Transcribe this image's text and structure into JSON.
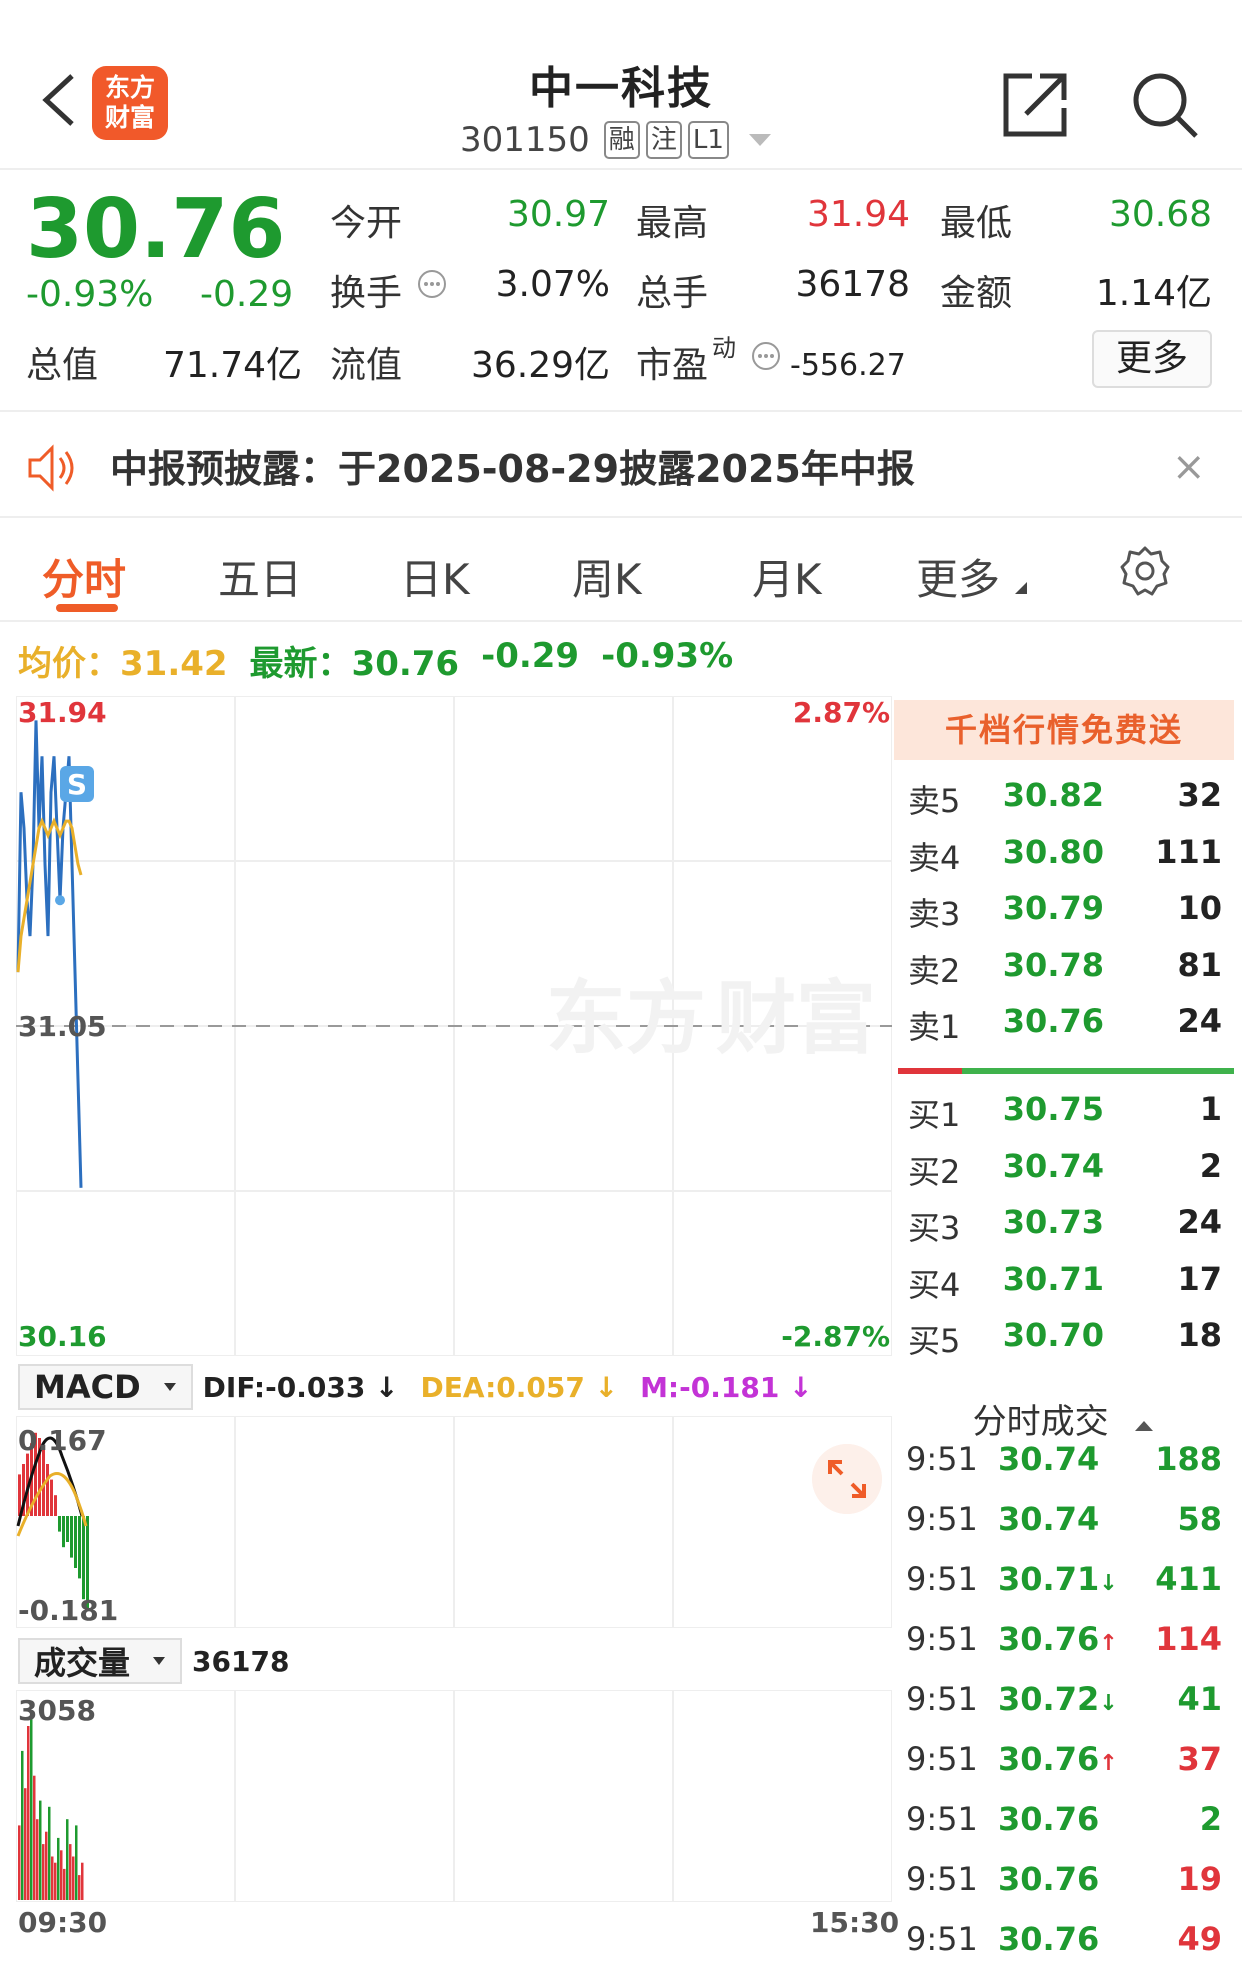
{
  "header": {
    "logo_line1": "东方",
    "logo_line2": "财富",
    "title": "中一科技",
    "code": "301150",
    "tags": [
      "融",
      "注",
      "L1"
    ]
  },
  "quote": {
    "price": "30.76",
    "pct": "-0.93%",
    "change": "-0.29",
    "fields": [
      {
        "label": "今开",
        "value": "30.97",
        "color": "green"
      },
      {
        "label": "最高",
        "value": "31.94",
        "color": "red"
      },
      {
        "label": "最低",
        "value": "30.68",
        "color": "green"
      },
      {
        "label": "换手",
        "value": "3.07%",
        "color": "black"
      },
      {
        "label": "总手",
        "value": "36178",
        "color": "black"
      },
      {
        "label": "金额",
        "value": "1.14亿",
        "color": "black"
      },
      {
        "label": "总值",
        "value": "71.74亿",
        "color": "black"
      },
      {
        "label": "流值",
        "value": "36.29亿",
        "color": "black"
      },
      {
        "label": "市盈",
        "value": "-556.27",
        "color": "black"
      }
    ],
    "pe_superscript": "动",
    "more_label": "更多"
  },
  "notice": {
    "text": "中报预披露：于2025-08-29披露2025年中报",
    "close": "×"
  },
  "tabs": [
    "分时",
    "五日",
    "日K",
    "周K",
    "月K",
    "更多"
  ],
  "info_row": {
    "avg_label": "均价：",
    "avg_value": "31.42",
    "latest_label": "最新：",
    "latest_value": "30.76",
    "latest_change": "-0.29",
    "latest_pct": "-0.93%"
  },
  "chart_data": {
    "type": "line",
    "y_high": "31.94",
    "y_mid": "31.05",
    "y_low": "30.16",
    "pct_high": "2.87%",
    "pct_low": "-2.87%",
    "ylim": [
      30.16,
      31.94
    ],
    "x_start": "09:30",
    "x_end": "15:30",
    "badge": "S",
    "series": [
      {
        "values": [
          31.2,
          31.7,
          31.6,
          31.4,
          31.3,
          31.5,
          31.9,
          31.6,
          31.8,
          31.5,
          31.3,
          31.7,
          31.8,
          31.6,
          31.4,
          31.6,
          31.7,
          31.8,
          31.5,
          31.2,
          30.9,
          30.6
        ]
      },
      {
        "values": [
          31.2,
          31.3,
          31.35,
          31.4,
          31.45,
          31.5,
          31.55,
          31.6,
          31.62,
          31.6,
          31.58,
          31.6,
          31.62,
          31.6,
          31.58,
          31.6,
          31.62,
          31.62,
          31.6,
          31.55,
          31.5,
          31.47
        ]
      }
    ]
  },
  "macd": {
    "selector": "MACD",
    "dif": "DIF:-0.033",
    "dea": "DEA:0.057",
    "m": "M:-0.181",
    "arrow": "↓",
    "top": "0.167",
    "bottom": "-0.181",
    "histogram": [
      0.08,
      0.1,
      0.12,
      0.14,
      0.16,
      0.15,
      0.13,
      0.1,
      0.07,
      0.04,
      -0.03,
      -0.06,
      -0.05,
      -0.08,
      -0.1,
      -0.12,
      -0.16,
      -0.18
    ]
  },
  "volume": {
    "selector": "成交量",
    "total": "36178",
    "max": "3058",
    "bars": [
      1200,
      2400,
      1800,
      2800,
      3058,
      2000,
      1300,
      1600,
      900,
      1100,
      1500,
      700,
      600,
      1000,
      800,
      500,
      1300,
      900,
      700,
      1200,
      400,
      600
    ]
  },
  "orderbook": {
    "header": "千档行情免费送",
    "asks": [
      {
        "name": "卖5",
        "price": "30.82",
        "qty": "32",
        "color": "green"
      },
      {
        "name": "卖4",
        "price": "30.80",
        "qty": "111",
        "color": "green"
      },
      {
        "name": "卖3",
        "price": "30.79",
        "qty": "10",
        "color": "green"
      },
      {
        "name": "卖2",
        "price": "30.78",
        "qty": "81",
        "color": "green"
      },
      {
        "name": "卖1",
        "price": "30.76",
        "qty": "24",
        "color": "green"
      }
    ],
    "bids": [
      {
        "name": "买1",
        "price": "30.75",
        "qty": "1",
        "color": "green"
      },
      {
        "name": "买2",
        "price": "30.74",
        "qty": "2",
        "color": "green"
      },
      {
        "name": "买3",
        "price": "30.73",
        "qty": "24",
        "color": "green"
      },
      {
        "name": "买4",
        "price": "30.71",
        "qty": "17",
        "color": "green"
      },
      {
        "name": "买5",
        "price": "30.70",
        "qty": "18",
        "color": "green"
      }
    ]
  },
  "trades": {
    "title": "分时成交",
    "rows": [
      {
        "time": "9:51",
        "price": "30.74",
        "arrow": "",
        "qty": "188",
        "qcolor": "green"
      },
      {
        "time": "9:51",
        "price": "30.74",
        "arrow": "",
        "qty": "58",
        "qcolor": "green"
      },
      {
        "time": "9:51",
        "price": "30.71",
        "arrow": "↓",
        "qty": "411",
        "qcolor": "green"
      },
      {
        "time": "9:51",
        "price": "30.76",
        "arrow": "↑",
        "qty": "114",
        "qcolor": "red"
      },
      {
        "time": "9:51",
        "price": "30.72",
        "arrow": "↓",
        "qty": "41",
        "qcolor": "green"
      },
      {
        "time": "9:51",
        "price": "30.76",
        "arrow": "↑",
        "qty": "37",
        "qcolor": "red"
      },
      {
        "time": "9:51",
        "price": "30.76",
        "arrow": "",
        "qty": "2",
        "qcolor": "green"
      },
      {
        "time": "9:51",
        "price": "30.76",
        "arrow": "",
        "qty": "19",
        "qcolor": "red"
      },
      {
        "time": "9:51",
        "price": "30.76",
        "arrow": "",
        "qty": "49",
        "qcolor": "red"
      }
    ]
  },
  "colors": {
    "red": "#e0353b",
    "green": "#1e9a2f",
    "gold": "#e9b02a",
    "brand": "#ef5c28"
  }
}
